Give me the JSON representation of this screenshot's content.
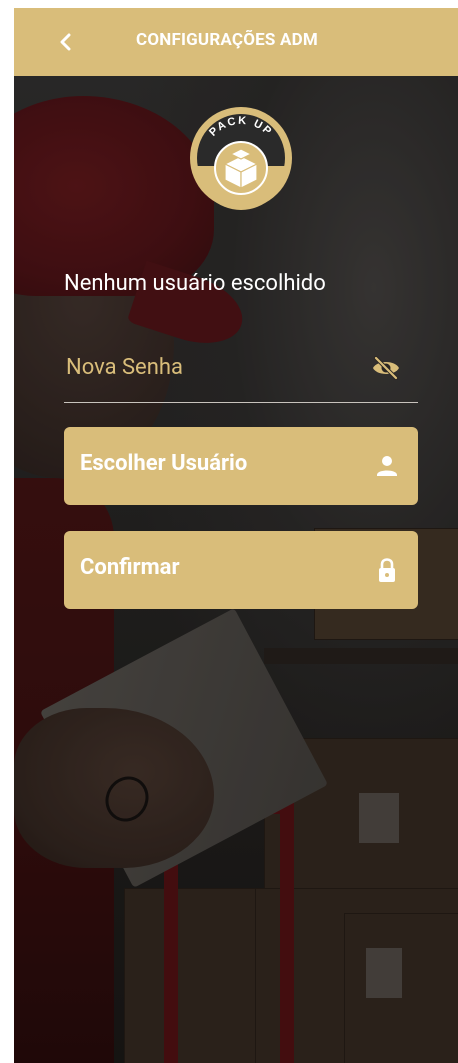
{
  "header": {
    "title": "CONFIGURAÇÕES ADM",
    "back_icon": "chevron-left-icon"
  },
  "logo": {
    "text": "PACK UP",
    "icon": "boxes-logo"
  },
  "user_status": "Nenhum usuário escolhido",
  "password_field": {
    "placeholder": "Nova Senha",
    "value": "",
    "toggle_icon": "eye-off-icon"
  },
  "buttons": {
    "choose_user": {
      "label": "Escolher Usuário",
      "icon": "person-icon"
    },
    "confirm": {
      "label": "Confirmar",
      "icon": "lock-icon"
    }
  },
  "colors": {
    "accent": "#d9bd7a",
    "text_light": "#ffffff",
    "input_text": "#e6cf93"
  }
}
